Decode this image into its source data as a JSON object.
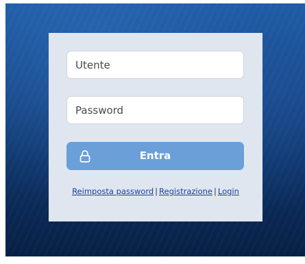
{
  "login": {
    "username_placeholder": "Utente",
    "password_placeholder": "Password",
    "submit_label": "Entra",
    "submit_icon": "lock-icon",
    "links": {
      "reset_password": "Reimposta password",
      "register": "Registrazione",
      "login": "Login",
      "separator": "|"
    }
  },
  "colors": {
    "button_bg": "#6a9fd8",
    "card_bg": "#dfe6ef",
    "link": "#1c3fa0",
    "background_top": "#1f5da6",
    "background_bottom": "#082044"
  }
}
